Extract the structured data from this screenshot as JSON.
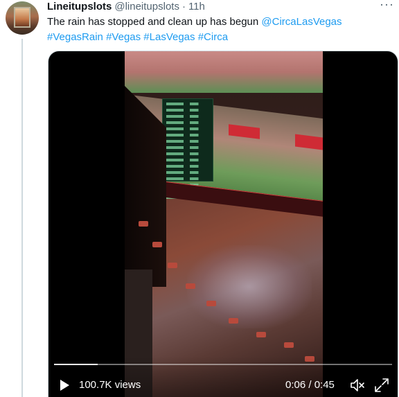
{
  "tweet": {
    "display_name": "Lineitupslots",
    "handle": "@lineitupslots",
    "separator": "·",
    "time": "11h",
    "more_icon": "ellipsis-icon",
    "text_plain": "The rain has stopped and clean up has begun ",
    "mention": "@CircaLasVegas",
    "hashtags": [
      "#VegasRain",
      "#Vegas",
      "#LasVegas",
      "#Circa"
    ],
    "link_color": "#1d9bf0"
  },
  "video": {
    "views": "100.7K views",
    "timecode": "0:06 / 0:45",
    "progress": 0.13,
    "play_icon": "play-icon",
    "mute_icon": "mute-icon",
    "fullscreen_icon": "fullscreen-icon"
  }
}
